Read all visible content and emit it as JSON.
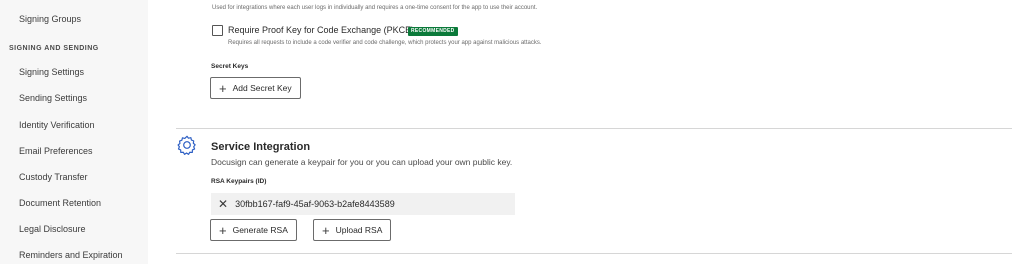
{
  "sidebar": {
    "items_top": [
      {
        "label": "Signing Groups"
      }
    ],
    "section_title": "SIGNING AND SENDING",
    "items": [
      {
        "label": "Signing Settings"
      },
      {
        "label": "Sending Settings"
      },
      {
        "label": "Identity Verification"
      },
      {
        "label": "Email Preferences"
      },
      {
        "label": "Custody Transfer"
      },
      {
        "label": "Document Retention"
      },
      {
        "label": "Legal Disclosure"
      },
      {
        "label": "Reminders and Expiration"
      }
    ]
  },
  "auth": {
    "intro_text": "Used for integrations where each user logs in individually and requires a one-time consent for the app to use their account.",
    "pkce_label": "Require Proof Key for Code Exchange (PKCE)",
    "pkce_checked": false,
    "pkce_badge": "RECOMMENDED",
    "pkce_help": "Requires all requests to include a code verifier and code challenge, which protects your app against malicious attacks.",
    "secret_keys_label": "Secret Keys",
    "add_secret_button": "Add Secret Key"
  },
  "service": {
    "title": "Service Integration",
    "description": "Docusign can generate a keypair for you or you can upload your own public key.",
    "rsa_label": "RSA Keypairs (ID)",
    "keypairs": [
      {
        "id": "30fbb167-faf9-45af-9063-b2afe8443589"
      }
    ],
    "generate_button": "Generate RSA",
    "upload_button": "Upload RSA"
  },
  "colors": {
    "badge_green": "#0b7a3a",
    "gear_blue": "#2d5fc4",
    "sidebar_bg": "#f7f7f7"
  },
  "icons": {
    "gear": "gear-icon",
    "plus": "plus-icon",
    "remove": "close-icon"
  }
}
